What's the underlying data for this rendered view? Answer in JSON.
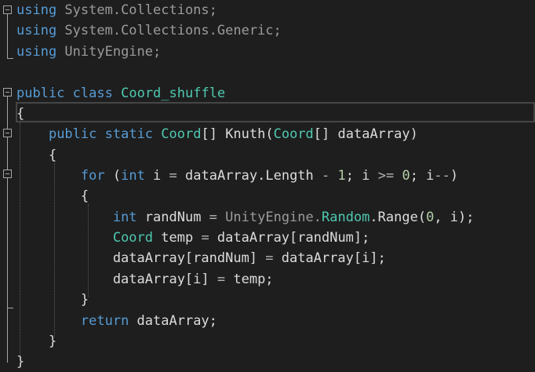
{
  "code": {
    "lines": [
      {
        "t": [
          {
            "c": "kw",
            "v": "using"
          },
          {
            "c": "ns",
            "v": " System.Collections;"
          }
        ]
      },
      {
        "t": [
          {
            "c": "kw",
            "v": "using"
          },
          {
            "c": "ns",
            "v": " System.Collections.Generic;"
          }
        ]
      },
      {
        "t": [
          {
            "c": "kw",
            "v": "using"
          },
          {
            "c": "ns",
            "v": " UnityEngine;"
          }
        ]
      },
      {
        "t": []
      },
      {
        "t": [
          {
            "c": "kw",
            "v": "public"
          },
          {
            "c": "id",
            "v": " "
          },
          {
            "c": "kw",
            "v": "class"
          },
          {
            "c": "id",
            "v": " "
          },
          {
            "c": "ty",
            "v": "Coord_shuffle"
          }
        ]
      },
      {
        "t": [
          {
            "c": "id",
            "v": "{"
          }
        ]
      },
      {
        "t": [
          {
            "c": "id",
            "v": "    "
          },
          {
            "c": "kw",
            "v": "public"
          },
          {
            "c": "id",
            "v": " "
          },
          {
            "c": "kw",
            "v": "static"
          },
          {
            "c": "id",
            "v": " "
          },
          {
            "c": "ty",
            "v": "Coord"
          },
          {
            "c": "id",
            "v": "[] Knuth("
          },
          {
            "c": "ty",
            "v": "Coord"
          },
          {
            "c": "id",
            "v": "[] dataArray)"
          }
        ]
      },
      {
        "t": [
          {
            "c": "id",
            "v": "    {"
          }
        ]
      },
      {
        "t": [
          {
            "c": "id",
            "v": "        "
          },
          {
            "c": "kw",
            "v": "for"
          },
          {
            "c": "id",
            "v": " ("
          },
          {
            "c": "kw",
            "v": "int"
          },
          {
            "c": "id",
            "v": " i "
          },
          {
            "c": "op",
            "v": "="
          },
          {
            "c": "id",
            "v": " dataArray.Length "
          },
          {
            "c": "op",
            "v": "-"
          },
          {
            "c": "id",
            "v": " "
          },
          {
            "c": "num",
            "v": "1"
          },
          {
            "c": "id",
            "v": "; i "
          },
          {
            "c": "op",
            "v": ">="
          },
          {
            "c": "id",
            "v": " "
          },
          {
            "c": "num",
            "v": "0"
          },
          {
            "c": "id",
            "v": "; i"
          },
          {
            "c": "op",
            "v": "--"
          },
          {
            "c": "id",
            "v": ")"
          }
        ]
      },
      {
        "t": [
          {
            "c": "id",
            "v": "        {"
          }
        ]
      },
      {
        "t": [
          {
            "c": "id",
            "v": "            "
          },
          {
            "c": "kw",
            "v": "int"
          },
          {
            "c": "id",
            "v": " randNum "
          },
          {
            "c": "op",
            "v": "="
          },
          {
            "c": "id",
            "v": " "
          },
          {
            "c": "ns",
            "v": "UnityEngine."
          },
          {
            "c": "ty",
            "v": "Random"
          },
          {
            "c": "id",
            "v": ".Range("
          },
          {
            "c": "num",
            "v": "0"
          },
          {
            "c": "id",
            "v": ", i);"
          }
        ]
      },
      {
        "t": [
          {
            "c": "id",
            "v": "            "
          },
          {
            "c": "ty",
            "v": "Coord"
          },
          {
            "c": "id",
            "v": " temp "
          },
          {
            "c": "op",
            "v": "="
          },
          {
            "c": "id",
            "v": " dataArray[randNum];"
          }
        ]
      },
      {
        "t": [
          {
            "c": "id",
            "v": "            dataArray[randNum] "
          },
          {
            "c": "op",
            "v": "="
          },
          {
            "c": "id",
            "v": " dataArray[i];"
          }
        ]
      },
      {
        "t": [
          {
            "c": "id",
            "v": "            dataArray[i] "
          },
          {
            "c": "op",
            "v": "="
          },
          {
            "c": "id",
            "v": " temp;"
          }
        ]
      },
      {
        "t": [
          {
            "c": "id",
            "v": "        }"
          }
        ]
      },
      {
        "t": [
          {
            "c": "id",
            "v": "        "
          },
          {
            "c": "kw",
            "v": "return"
          },
          {
            "c": "id",
            "v": " dataArray;"
          }
        ]
      },
      {
        "t": [
          {
            "c": "id",
            "v": "    }"
          }
        ]
      },
      {
        "t": [
          {
            "c": "id",
            "v": "}"
          }
        ]
      }
    ]
  },
  "colors": {
    "background": "#1e1e1e",
    "keyword": "#569cd6",
    "type": "#4ec9b0",
    "namespace": "#9b9b9b",
    "number": "#b5cea8",
    "operator": "#b4b4b4",
    "text": "#dcdcdc"
  },
  "icons": [
    "fold-collapse-icon"
  ]
}
